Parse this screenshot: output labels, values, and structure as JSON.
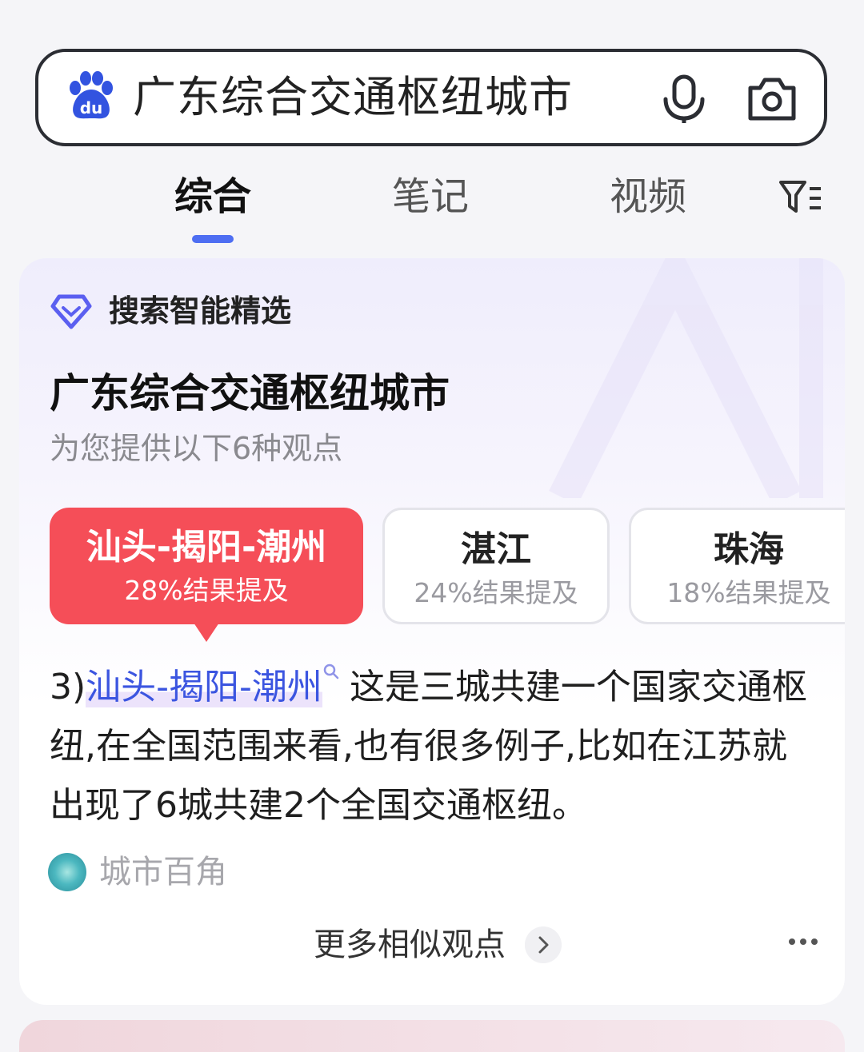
{
  "search": {
    "query": "广东综合交通枢纽城市"
  },
  "tabs": [
    {
      "label": "综合",
      "active": true
    },
    {
      "label": "笔记",
      "active": false
    },
    {
      "label": "视频",
      "active": false
    }
  ],
  "card": {
    "badge": "搜索智能精选",
    "title": "广东综合交通枢纽城市",
    "subtitle": "为您提供以下6种观点",
    "chips": [
      {
        "name": "汕头-揭阳-潮州",
        "pct": "28%结果提及",
        "selected": true
      },
      {
        "name": "湛江",
        "pct": "24%结果提及",
        "selected": false
      },
      {
        "name": "珠海",
        "pct": "18%结果提及",
        "selected": false
      }
    ],
    "answer": {
      "prefix": "3)",
      "entity": "汕头-揭阳-潮州",
      "text": "这是三城共建一个国家交通枢纽,在全国范围来看,也有很多例子,比如在江苏就出现了6城共建2个全国交通枢纽。"
    },
    "source": "城市百角",
    "more_label": "更多相似观点"
  },
  "colors": {
    "accent": "#4e6ef2",
    "chip_selected": "#f54e58",
    "entity_link": "#3b55e0"
  },
  "icons": [
    "baidu-paw-logo",
    "mic-icon",
    "camera-icon",
    "filter-icon",
    "diamond-badge-icon",
    "search-mini-icon",
    "chevron-right-icon",
    "more-dots-icon"
  ]
}
